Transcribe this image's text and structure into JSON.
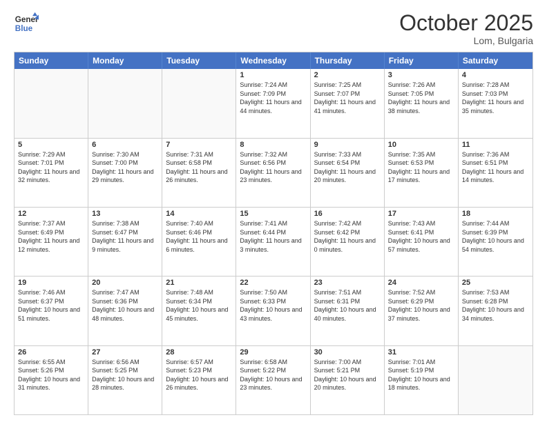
{
  "header": {
    "logo_line1": "General",
    "logo_line2": "Blue",
    "month": "October 2025",
    "location": "Lom, Bulgaria"
  },
  "days_of_week": [
    "Sunday",
    "Monday",
    "Tuesday",
    "Wednesday",
    "Thursday",
    "Friday",
    "Saturday"
  ],
  "weeks": [
    [
      {
        "day": "",
        "text": ""
      },
      {
        "day": "",
        "text": ""
      },
      {
        "day": "",
        "text": ""
      },
      {
        "day": "1",
        "text": "Sunrise: 7:24 AM\nSunset: 7:09 PM\nDaylight: 11 hours and 44 minutes."
      },
      {
        "day": "2",
        "text": "Sunrise: 7:25 AM\nSunset: 7:07 PM\nDaylight: 11 hours and 41 minutes."
      },
      {
        "day": "3",
        "text": "Sunrise: 7:26 AM\nSunset: 7:05 PM\nDaylight: 11 hours and 38 minutes."
      },
      {
        "day": "4",
        "text": "Sunrise: 7:28 AM\nSunset: 7:03 PM\nDaylight: 11 hours and 35 minutes."
      }
    ],
    [
      {
        "day": "5",
        "text": "Sunrise: 7:29 AM\nSunset: 7:01 PM\nDaylight: 11 hours and 32 minutes."
      },
      {
        "day": "6",
        "text": "Sunrise: 7:30 AM\nSunset: 7:00 PM\nDaylight: 11 hours and 29 minutes."
      },
      {
        "day": "7",
        "text": "Sunrise: 7:31 AM\nSunset: 6:58 PM\nDaylight: 11 hours and 26 minutes."
      },
      {
        "day": "8",
        "text": "Sunrise: 7:32 AM\nSunset: 6:56 PM\nDaylight: 11 hours and 23 minutes."
      },
      {
        "day": "9",
        "text": "Sunrise: 7:33 AM\nSunset: 6:54 PM\nDaylight: 11 hours and 20 minutes."
      },
      {
        "day": "10",
        "text": "Sunrise: 7:35 AM\nSunset: 6:53 PM\nDaylight: 11 hours and 17 minutes."
      },
      {
        "day": "11",
        "text": "Sunrise: 7:36 AM\nSunset: 6:51 PM\nDaylight: 11 hours and 14 minutes."
      }
    ],
    [
      {
        "day": "12",
        "text": "Sunrise: 7:37 AM\nSunset: 6:49 PM\nDaylight: 11 hours and 12 minutes."
      },
      {
        "day": "13",
        "text": "Sunrise: 7:38 AM\nSunset: 6:47 PM\nDaylight: 11 hours and 9 minutes."
      },
      {
        "day": "14",
        "text": "Sunrise: 7:40 AM\nSunset: 6:46 PM\nDaylight: 11 hours and 6 minutes."
      },
      {
        "day": "15",
        "text": "Sunrise: 7:41 AM\nSunset: 6:44 PM\nDaylight: 11 hours and 3 minutes."
      },
      {
        "day": "16",
        "text": "Sunrise: 7:42 AM\nSunset: 6:42 PM\nDaylight: 11 hours and 0 minutes."
      },
      {
        "day": "17",
        "text": "Sunrise: 7:43 AM\nSunset: 6:41 PM\nDaylight: 10 hours and 57 minutes."
      },
      {
        "day": "18",
        "text": "Sunrise: 7:44 AM\nSunset: 6:39 PM\nDaylight: 10 hours and 54 minutes."
      }
    ],
    [
      {
        "day": "19",
        "text": "Sunrise: 7:46 AM\nSunset: 6:37 PM\nDaylight: 10 hours and 51 minutes."
      },
      {
        "day": "20",
        "text": "Sunrise: 7:47 AM\nSunset: 6:36 PM\nDaylight: 10 hours and 48 minutes."
      },
      {
        "day": "21",
        "text": "Sunrise: 7:48 AM\nSunset: 6:34 PM\nDaylight: 10 hours and 45 minutes."
      },
      {
        "day": "22",
        "text": "Sunrise: 7:50 AM\nSunset: 6:33 PM\nDaylight: 10 hours and 43 minutes."
      },
      {
        "day": "23",
        "text": "Sunrise: 7:51 AM\nSunset: 6:31 PM\nDaylight: 10 hours and 40 minutes."
      },
      {
        "day": "24",
        "text": "Sunrise: 7:52 AM\nSunset: 6:29 PM\nDaylight: 10 hours and 37 minutes."
      },
      {
        "day": "25",
        "text": "Sunrise: 7:53 AM\nSunset: 6:28 PM\nDaylight: 10 hours and 34 minutes."
      }
    ],
    [
      {
        "day": "26",
        "text": "Sunrise: 6:55 AM\nSunset: 5:26 PM\nDaylight: 10 hours and 31 minutes."
      },
      {
        "day": "27",
        "text": "Sunrise: 6:56 AM\nSunset: 5:25 PM\nDaylight: 10 hours and 28 minutes."
      },
      {
        "day": "28",
        "text": "Sunrise: 6:57 AM\nSunset: 5:23 PM\nDaylight: 10 hours and 26 minutes."
      },
      {
        "day": "29",
        "text": "Sunrise: 6:58 AM\nSunset: 5:22 PM\nDaylight: 10 hours and 23 minutes."
      },
      {
        "day": "30",
        "text": "Sunrise: 7:00 AM\nSunset: 5:21 PM\nDaylight: 10 hours and 20 minutes."
      },
      {
        "day": "31",
        "text": "Sunrise: 7:01 AM\nSunset: 5:19 PM\nDaylight: 10 hours and 18 minutes."
      },
      {
        "day": "",
        "text": ""
      }
    ]
  ]
}
